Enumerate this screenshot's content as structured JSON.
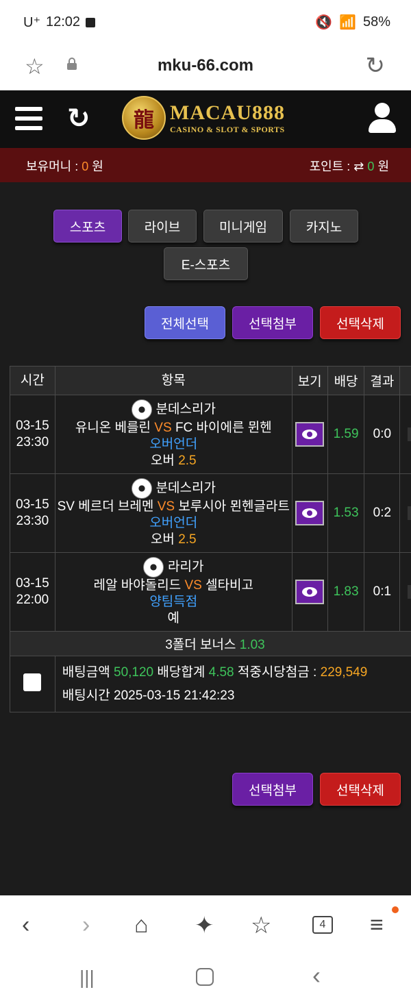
{
  "status": {
    "carrier": "U⁺",
    "time": "12:02",
    "battery": "58%"
  },
  "browser": {
    "url": "mku-66.com"
  },
  "header": {
    "logo_main": "MACAU888",
    "logo_sub": "CASINO & SLOT & SPORTS"
  },
  "balance": {
    "money_label": "보유머니 :",
    "money_value": "0",
    "money_unit": "원",
    "points_label": "포인트 :",
    "points_value": "0",
    "points_unit": "원"
  },
  "tabs": [
    {
      "label": "스포츠",
      "active": true
    },
    {
      "label": "라이브",
      "active": false
    },
    {
      "label": "미니게임",
      "active": false
    },
    {
      "label": "카지노",
      "active": false
    },
    {
      "label": "E-스포츠",
      "active": false
    }
  ],
  "actions": {
    "select_all": "전체선택",
    "attach": "선택첨부",
    "delete": "선택삭제"
  },
  "table": {
    "headers": {
      "time": "시간",
      "item": "항목",
      "view": "보기",
      "odds": "배당",
      "result": "결과"
    },
    "rows": [
      {
        "date": "03-15",
        "time": "23:30",
        "league": "분데스리가",
        "home": "유니온 베를린",
        "vs": "VS",
        "away": "FC 바이에른 뮌헨",
        "market": "오버언더",
        "pick": "오버",
        "line": "2.5",
        "odds": "1.59",
        "result": "0:0"
      },
      {
        "date": "03-15",
        "time": "23:30",
        "league": "분데스리가",
        "home": "SV 베르더 브레멘",
        "vs": "VS",
        "away": "보루시아 묀헨글라트",
        "market": "오버언더",
        "pick": "오버",
        "line": "2.5",
        "odds": "1.53",
        "result": "0:2"
      },
      {
        "date": "03-15",
        "time": "22:00",
        "league": "라리가",
        "home": "레알 바야돌리드",
        "vs": "VS",
        "away": "셀타비고",
        "market": "양팀득점",
        "pick": "예",
        "line": "",
        "odds": "1.83",
        "result": "0:1"
      }
    ],
    "bonus_label": "3폴더 보너스",
    "bonus_value": "1.03",
    "summary": {
      "bet_amount_label": "배팅금액",
      "bet_amount": "50,120",
      "odds_total_label": "배당합계",
      "odds_total": "4.58",
      "win_label": "적중시당첨금 :",
      "win_amount": "229,549",
      "bet_time_label": "배팅시간",
      "bet_time": "2025-03-15 21:42:23"
    }
  },
  "bottom": {
    "tab_count": "4"
  },
  "colors": {
    "accent_purple": "#6a1fa4",
    "red": "#c41c1c",
    "blue": "#5a5fd4",
    "balance_bar": "#5a0f10"
  }
}
